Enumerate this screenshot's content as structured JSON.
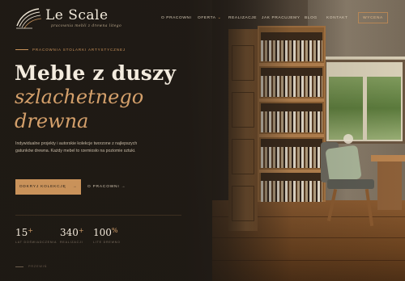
{
  "brand": {
    "name": "Le Scale",
    "tagline": "pracownia mebli z drewna litego"
  },
  "nav": {
    "items": [
      {
        "label": "O pracowni",
        "has_dropdown": false
      },
      {
        "label": "Oferta",
        "has_dropdown": true
      },
      {
        "label": "Realizacje",
        "has_dropdown": false
      },
      {
        "label": "Jak pracujemy",
        "has_dropdown": false
      },
      {
        "label": "Blog",
        "has_dropdown": false
      },
      {
        "label": "Kontakt",
        "has_dropdown": false
      }
    ],
    "cta_label": "Wycena"
  },
  "hero": {
    "eyebrow": "Pracownia stolarki artystycznej",
    "title_line1": "Meble z duszy",
    "title_line2": "szlachetnego",
    "title_line3": "drewna",
    "lead": "Indywidualne projekty i autorskie kolekcje tworzone z najlepszych gatunków drewna. Każdy mebel to rzemiosło na poziomie sztuki.",
    "primary_button": "Odkryj kolekcję",
    "secondary_link": "O pracowni"
  },
  "stats": [
    {
      "value": "15",
      "suffix": "+",
      "label": "lat doświadczenia"
    },
    {
      "value": "340",
      "suffix": "+",
      "label": "realizacji"
    },
    {
      "value": "100",
      "suffix": "%",
      "label": "lite drewno"
    }
  ],
  "scroll_hint": "Przewiń",
  "colors": {
    "accent": "#c9925a",
    "background": "#1c1814",
    "text": "#f4ecdf"
  }
}
